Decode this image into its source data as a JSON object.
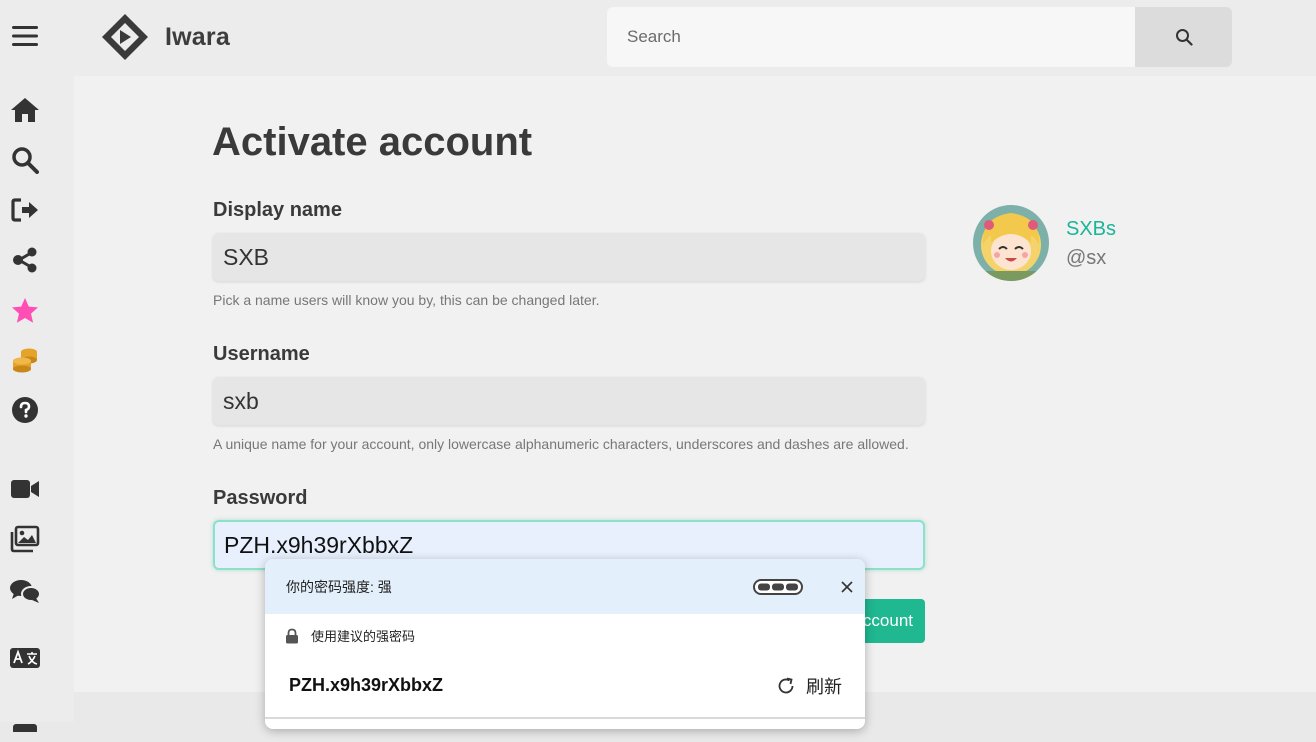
{
  "header": {
    "brand": "Iwara",
    "search_placeholder": "Search"
  },
  "sidebar": {
    "icons": [
      "menu-icon",
      "home-icon",
      "search-icon",
      "sign-in-icon",
      "share-icon",
      "star-icon",
      "coins-icon",
      "help-icon",
      "video-icon",
      "images-icon",
      "chat-icon",
      "language-icon"
    ],
    "accent_colors": {
      "star": "#ff4fb5",
      "coins": "#e5a32a"
    }
  },
  "form": {
    "title": "Activate account",
    "display_name": {
      "label": "Display name",
      "value": "SXB",
      "help": "Pick a name users will know you by, this can be changed later."
    },
    "username": {
      "label": "Username",
      "value": "sxb",
      "help": "A unique name for your account, only lowercase alphanumeric characters, underscores and dashes are allowed."
    },
    "password": {
      "label": "Password",
      "value": "PZH.x9h39rXbbxZ"
    },
    "submit_label": "ccount"
  },
  "profile": {
    "display_name": "SXBs",
    "handle": "@sx"
  },
  "password_popup": {
    "strength_text": "你的密码强度: 强",
    "suggest_text": "使用建议的强密码",
    "suggested_password": "PZH.x9h39rXbbxZ",
    "refresh_label": "刷新"
  },
  "colors": {
    "accent": "#1fb891",
    "profile_name": "#1ab597"
  }
}
